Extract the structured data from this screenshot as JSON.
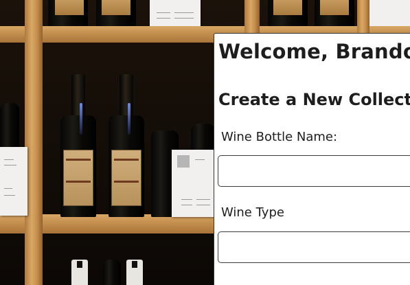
{
  "page": {
    "background": "wine-shelf-photo",
    "panel_background": "#ffffff"
  },
  "header": {
    "welcome_text": "Welcome, Brandon!"
  },
  "form": {
    "title": "Create a New Collection",
    "fields": [
      {
        "label": "Wine Bottle Name:",
        "value": "",
        "placeholder": ""
      },
      {
        "label": "Wine Type",
        "value": "",
        "placeholder": ""
      }
    ],
    "next_label_partial": "..."
  }
}
